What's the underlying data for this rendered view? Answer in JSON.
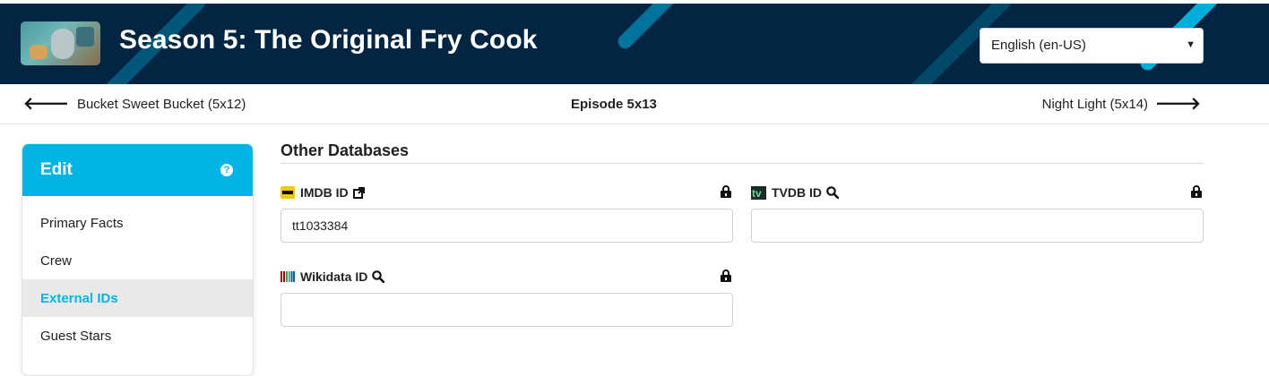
{
  "header": {
    "title": "Season 5: The Original Fry Cook",
    "language_select": {
      "value": "English (en-US)"
    },
    "colors": {
      "background": "#032541",
      "accent": "#01b4e4"
    }
  },
  "episode_nav": {
    "prev_label": "Bucket Sweet Bucket (5x12)",
    "current_label": "Episode 5x13",
    "next_label": "Night Light (5x14)"
  },
  "sidebar": {
    "title": "Edit",
    "items": [
      {
        "label": "Primary Facts",
        "active": false
      },
      {
        "label": "Crew",
        "active": false
      },
      {
        "label": "External IDs",
        "active": true
      },
      {
        "label": "Guest Stars",
        "active": false
      }
    ]
  },
  "main": {
    "section_title": "Other Databases",
    "fields": {
      "imdb": {
        "label": "IMDB ID",
        "value": "tt1033384",
        "icon": "imdb-logo-icon",
        "locked": true
      },
      "tvdb": {
        "label": "TVDB ID",
        "value": "",
        "icon": "tvdb-logo-icon",
        "locked": true
      },
      "wikidata": {
        "label": "Wikidata ID",
        "value": "",
        "icon": "wikidata-logo-icon",
        "locked": true
      }
    }
  }
}
